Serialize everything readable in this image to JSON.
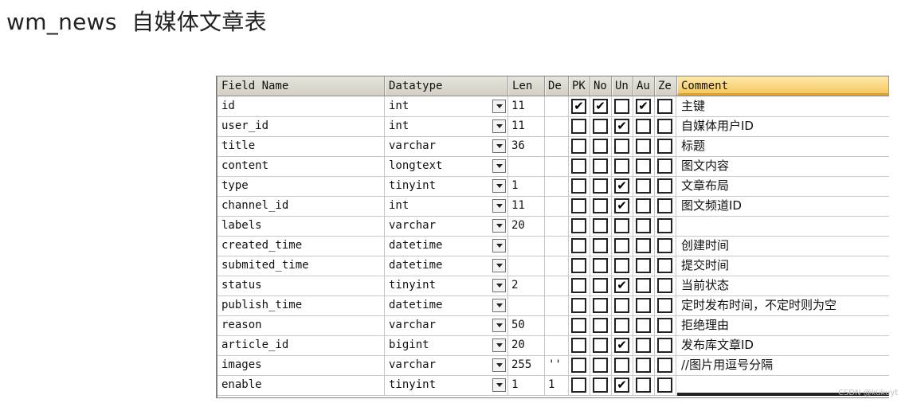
{
  "page": {
    "title": "wm_news  自媒体文章表"
  },
  "grid": {
    "headers": {
      "field_name": "Field Name",
      "datatype": "Datatype",
      "len": "Len",
      "default": "De",
      "pk": "PK",
      "not_null": "No",
      "unsigned": "Un",
      "auto_increment": "Au",
      "zerofill": "Ze",
      "comment": "Comment"
    },
    "rows": [
      {
        "name": "id",
        "type": "int",
        "len": "11",
        "default": "",
        "pk": true,
        "not_null": true,
        "unsigned": false,
        "auto_inc": true,
        "zerofill": false,
        "comment": "主键"
      },
      {
        "name": "user_id",
        "type": "int",
        "len": "11",
        "default": "",
        "pk": false,
        "not_null": false,
        "unsigned": true,
        "auto_inc": false,
        "zerofill": false,
        "comment": "自媒体用户ID"
      },
      {
        "name": "title",
        "type": "varchar",
        "len": "36",
        "default": "",
        "pk": false,
        "not_null": false,
        "unsigned": false,
        "auto_inc": false,
        "zerofill": false,
        "comment": "标题"
      },
      {
        "name": "content",
        "type": "longtext",
        "len": "",
        "default": "",
        "pk": false,
        "not_null": false,
        "unsigned": false,
        "auto_inc": false,
        "zerofill": false,
        "comment": "图文内容"
      },
      {
        "name": "type",
        "type": "tinyint",
        "len": "1",
        "default": "",
        "pk": false,
        "not_null": false,
        "unsigned": true,
        "auto_inc": false,
        "zerofill": false,
        "comment": "文章布局"
      },
      {
        "name": "channel_id",
        "type": "int",
        "len": "11",
        "default": "",
        "pk": false,
        "not_null": false,
        "unsigned": true,
        "auto_inc": false,
        "zerofill": false,
        "comment": "图文频道ID"
      },
      {
        "name": "labels",
        "type": "varchar",
        "len": "20",
        "default": "",
        "pk": false,
        "not_null": false,
        "unsigned": false,
        "auto_inc": false,
        "zerofill": false,
        "comment": ""
      },
      {
        "name": "created_time",
        "type": "datetime",
        "len": "",
        "default": "",
        "pk": false,
        "not_null": false,
        "unsigned": false,
        "auto_inc": false,
        "zerofill": false,
        "comment": "创建时间"
      },
      {
        "name": "submited_time",
        "type": "datetime",
        "len": "",
        "default": "",
        "pk": false,
        "not_null": false,
        "unsigned": false,
        "auto_inc": false,
        "zerofill": false,
        "comment": "提交时间"
      },
      {
        "name": "status",
        "type": "tinyint",
        "len": "2",
        "default": "",
        "pk": false,
        "not_null": false,
        "unsigned": true,
        "auto_inc": false,
        "zerofill": false,
        "comment": "当前状态"
      },
      {
        "name": "publish_time",
        "type": "datetime",
        "len": "",
        "default": "",
        "pk": false,
        "not_null": false,
        "unsigned": false,
        "auto_inc": false,
        "zerofill": false,
        "comment": "定时发布时间，不定时则为空"
      },
      {
        "name": "reason",
        "type": "varchar",
        "len": "50",
        "default": "",
        "pk": false,
        "not_null": false,
        "unsigned": false,
        "auto_inc": false,
        "zerofill": false,
        "comment": "拒绝理由"
      },
      {
        "name": "article_id",
        "type": "bigint",
        "len": "20",
        "default": "",
        "pk": false,
        "not_null": false,
        "unsigned": true,
        "auto_inc": false,
        "zerofill": false,
        "comment": "发布库文章ID"
      },
      {
        "name": "images",
        "type": "varchar",
        "len": "255",
        "default": "''",
        "pk": false,
        "not_null": false,
        "unsigned": false,
        "auto_inc": false,
        "zerofill": false,
        "comment": "//图片用逗号分隔"
      },
      {
        "name": "enable",
        "type": "tinyint",
        "len": "1",
        "default": "1",
        "pk": false,
        "not_null": false,
        "unsigned": true,
        "auto_inc": false,
        "zerofill": false,
        "comment": ""
      }
    ]
  },
  "icons": {
    "dropdown": "chevron-down-icon",
    "check": "checkmark-icon"
  },
  "watermark": "CSDN @kukuyt"
}
